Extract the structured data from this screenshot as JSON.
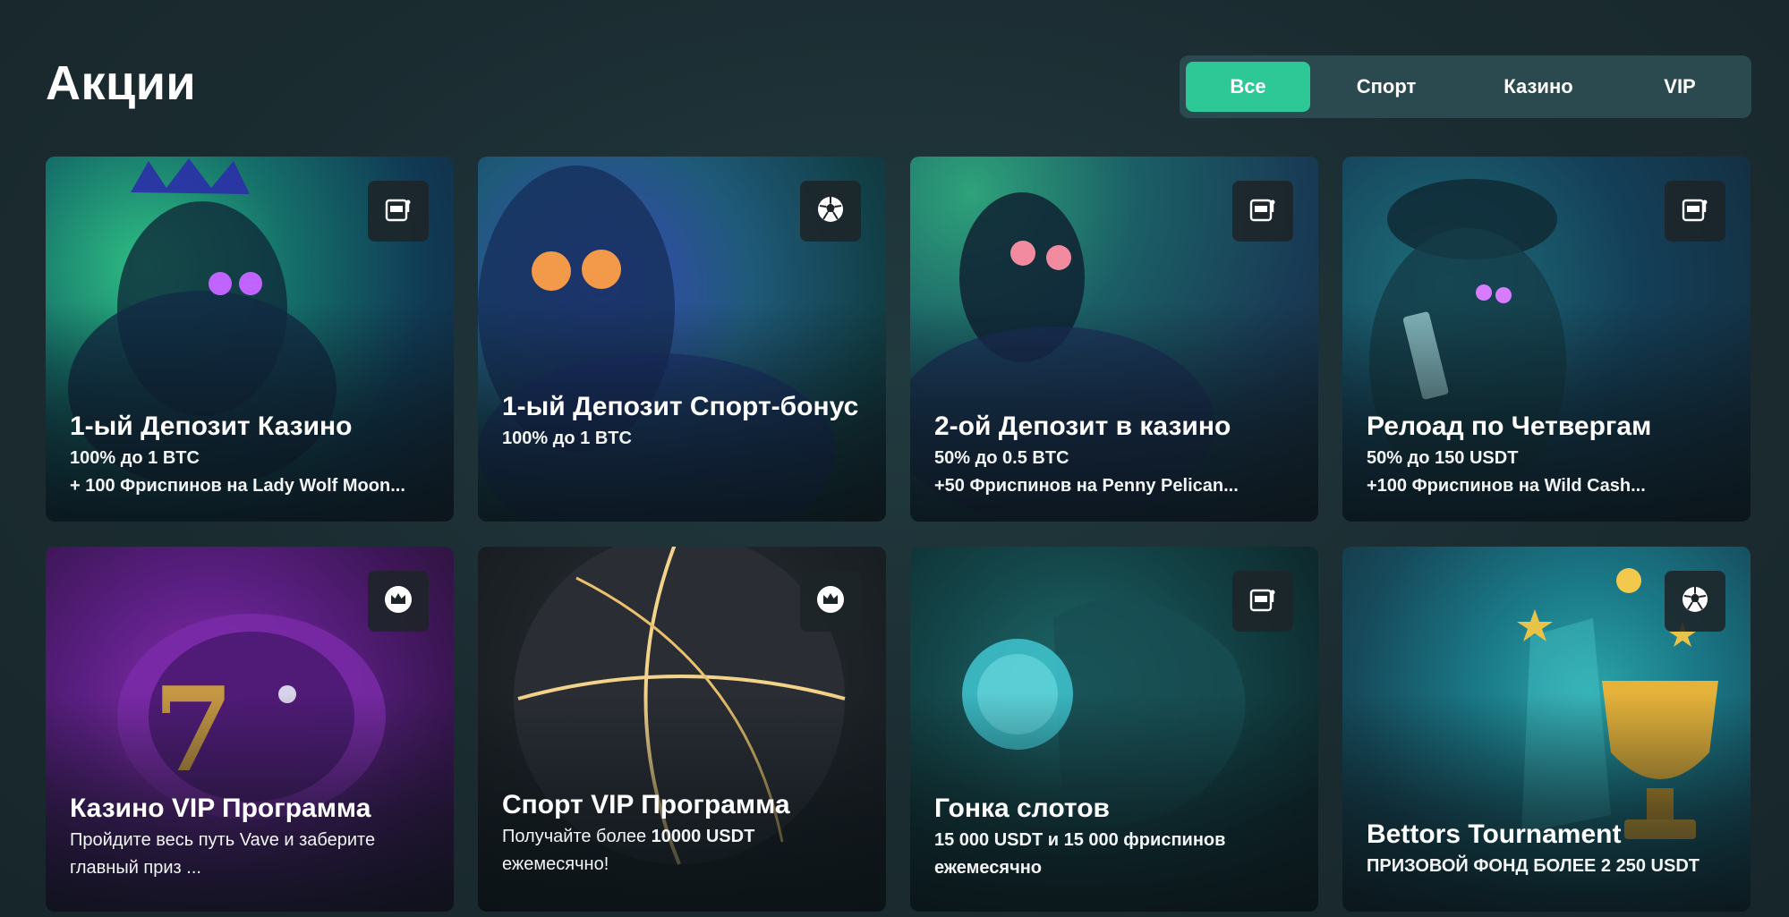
{
  "page": {
    "title": "Акции"
  },
  "filters": [
    {
      "label": "Все",
      "active": true
    },
    {
      "label": "Спорт",
      "active": false
    },
    {
      "label": "Казино",
      "active": false
    },
    {
      "label": "VIP",
      "active": false
    }
  ],
  "colors": {
    "accent": "#2ec796",
    "tabs_bg": "#2b4a4f",
    "page_bg": "#1b2c31"
  },
  "promos": [
    {
      "title": "1-ый Депозит Казино",
      "line1": "100% до 1 BTC",
      "line2": "+ 100 Фриспинов на Lady Wolf Moon...",
      "icon": "slot-machine-icon"
    },
    {
      "title": "1-ый Депозит Спорт-бонус",
      "line1": "100% до 1 BTC",
      "line2": "",
      "icon": "soccer-ball-icon"
    },
    {
      "title": "2-ой Депозит в казино",
      "line1": "50% до 0.5 BTC",
      "line2": "+50 Фриспинов на Penny Pelican...",
      "icon": "slot-machine-icon"
    },
    {
      "title": "Релоад по Четвергам",
      "line1": "50% до 150 USDT",
      "line2": "+100 Фриспинов на Wild Cash...",
      "icon": "slot-machine-icon"
    },
    {
      "title": "Казино VIP Программа",
      "line1": "Пройдите весь путь Vave и заберите",
      "line2": "главный приз ...",
      "icon": "crown-icon"
    },
    {
      "title": "Спорт VIP Программа",
      "line1_pre": "Получайте более ",
      "line1_bold": "10000 USDT",
      "line2": "ежемесячно!",
      "icon": "crown-icon"
    },
    {
      "title": "Гонка слотов",
      "line1": "15 000 USDT и 15 000 фриспинов",
      "line2": "ежемесячно",
      "icon": "slot-machine-icon"
    },
    {
      "title": "Bettors Tournament",
      "line1": "ПРИЗОВОЙ ФОНД БОЛЕЕ 2 250 USDT",
      "line2": "",
      "icon": "soccer-ball-icon"
    }
  ]
}
